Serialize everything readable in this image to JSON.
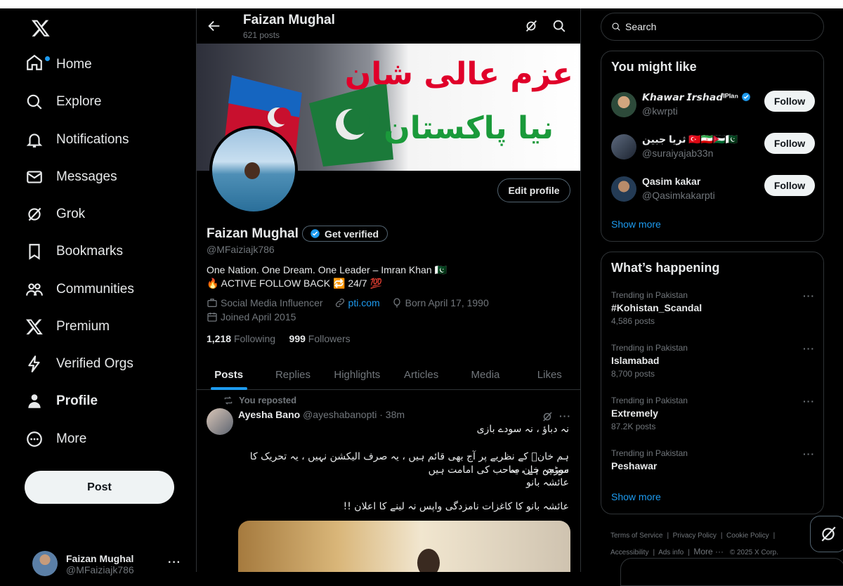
{
  "nav": {
    "items": [
      {
        "label": "Home",
        "icon": "home-icon"
      },
      {
        "label": "Explore",
        "icon": "search-icon"
      },
      {
        "label": "Notifications",
        "icon": "bell-icon"
      },
      {
        "label": "Messages",
        "icon": "envelope-icon"
      },
      {
        "label": "Grok",
        "icon": "grok-icon"
      },
      {
        "label": "Bookmarks",
        "icon": "bookmark-icon"
      },
      {
        "label": "Communities",
        "icon": "communities-icon"
      },
      {
        "label": "Premium",
        "icon": "x-logo-icon"
      },
      {
        "label": "Verified Orgs",
        "icon": "lightning-icon"
      },
      {
        "label": "Profile",
        "icon": "person-icon"
      },
      {
        "label": "More",
        "icon": "more-circle-icon"
      }
    ],
    "post_label": "Post",
    "account": {
      "name": "Faizan Mughal",
      "handle": "@MFaiziajk786"
    }
  },
  "header": {
    "name": "Faizan Mughal",
    "posts": "621 posts"
  },
  "banner": {
    "line1": "عزم عالی شان",
    "line2": "نیا پاکستان"
  },
  "profile": {
    "edit_label": "Edit profile",
    "name": "Faizan Mughal",
    "get_verified": "Get verified",
    "handle": "@MFaiziajk786",
    "bio_line1": "One Nation. One Dream. One Leader – Imran Khan 🇵🇰",
    "bio_line2": "🔥 ACTIVE FOLLOW BACK 🔁 24/7 💯",
    "category": "Social Media Influencer",
    "website": "pti.com",
    "born": "Born April 17, 1990",
    "joined": "Joined April 2015",
    "following_count": "1,218",
    "following_label": "Following",
    "followers_count": "999",
    "followers_label": "Followers"
  },
  "tabs": [
    "Posts",
    "Replies",
    "Highlights",
    "Articles",
    "Media",
    "Likes"
  ],
  "tweet": {
    "repost_label": "You reposted",
    "author": "Ayesha Bano",
    "handle_time": "@ayeshabanopti · 38m",
    "line1": "نہ دباؤ ، نہ سودے بازی",
    "line2": "ہم خانؒ کے نظریے پر آج بھی قائم ہیں ، یہ صرف الیکشن نہیں ، یہ تحریک کا مورچہ ہے ، یہ",
    "line3": "سیٹس خان صاحب کی امامت ہیں",
    "line4": "عائشہ بانو",
    "line5": "عائشہ بانو کا کاغزات نامزدگی واپس نہ لینے کا اعلان !!"
  },
  "search": {
    "placeholder": "Search"
  },
  "suggestions": {
    "title": "You might like",
    "items": [
      {
        "name": "𝙆𝙝𝙖𝙬𝙖𝙧 𝙄𝙧𝙨𝙝𝙖𝙙ᴵᴾᴵᵃⁿ",
        "handle": "@kwrpti",
        "follow": "Follow"
      },
      {
        "name": "ثریا جبین 🇹🇷🇮🇷🇯🇴🇵🇰",
        "handle": "@suraiyajab33n",
        "follow": "Follow"
      },
      {
        "name": "Qasim kakar",
        "handle": "@Qasimkakarpti",
        "follow": "Follow"
      }
    ],
    "show_more": "Show more"
  },
  "trends": {
    "title": "What’s happening",
    "items": [
      {
        "context": "Trending in Pakistan",
        "topic": "#Kohistan_Scandal",
        "count": "4,586 posts"
      },
      {
        "context": "Trending in Pakistan",
        "topic": "Islamabad",
        "count": "8,700 posts"
      },
      {
        "context": "Trending in Pakistan",
        "topic": "Extremely",
        "count": "87.2K posts"
      },
      {
        "context": "Trending in Pakistan",
        "topic": "Peshawar",
        "count": ""
      }
    ],
    "show_more": "Show more"
  },
  "footer": {
    "terms": "Terms of Service",
    "privacy": "Privacy Policy",
    "cookie": "Cookie Policy",
    "accessibility": "Accessibility",
    "ads": "Ads info",
    "more": "More ···",
    "copyright": "© 2025 X Corp."
  },
  "colors": {
    "accent": "#1d9bf0",
    "background": "#000000",
    "text": "#e7e9ea",
    "muted": "#71767b"
  }
}
